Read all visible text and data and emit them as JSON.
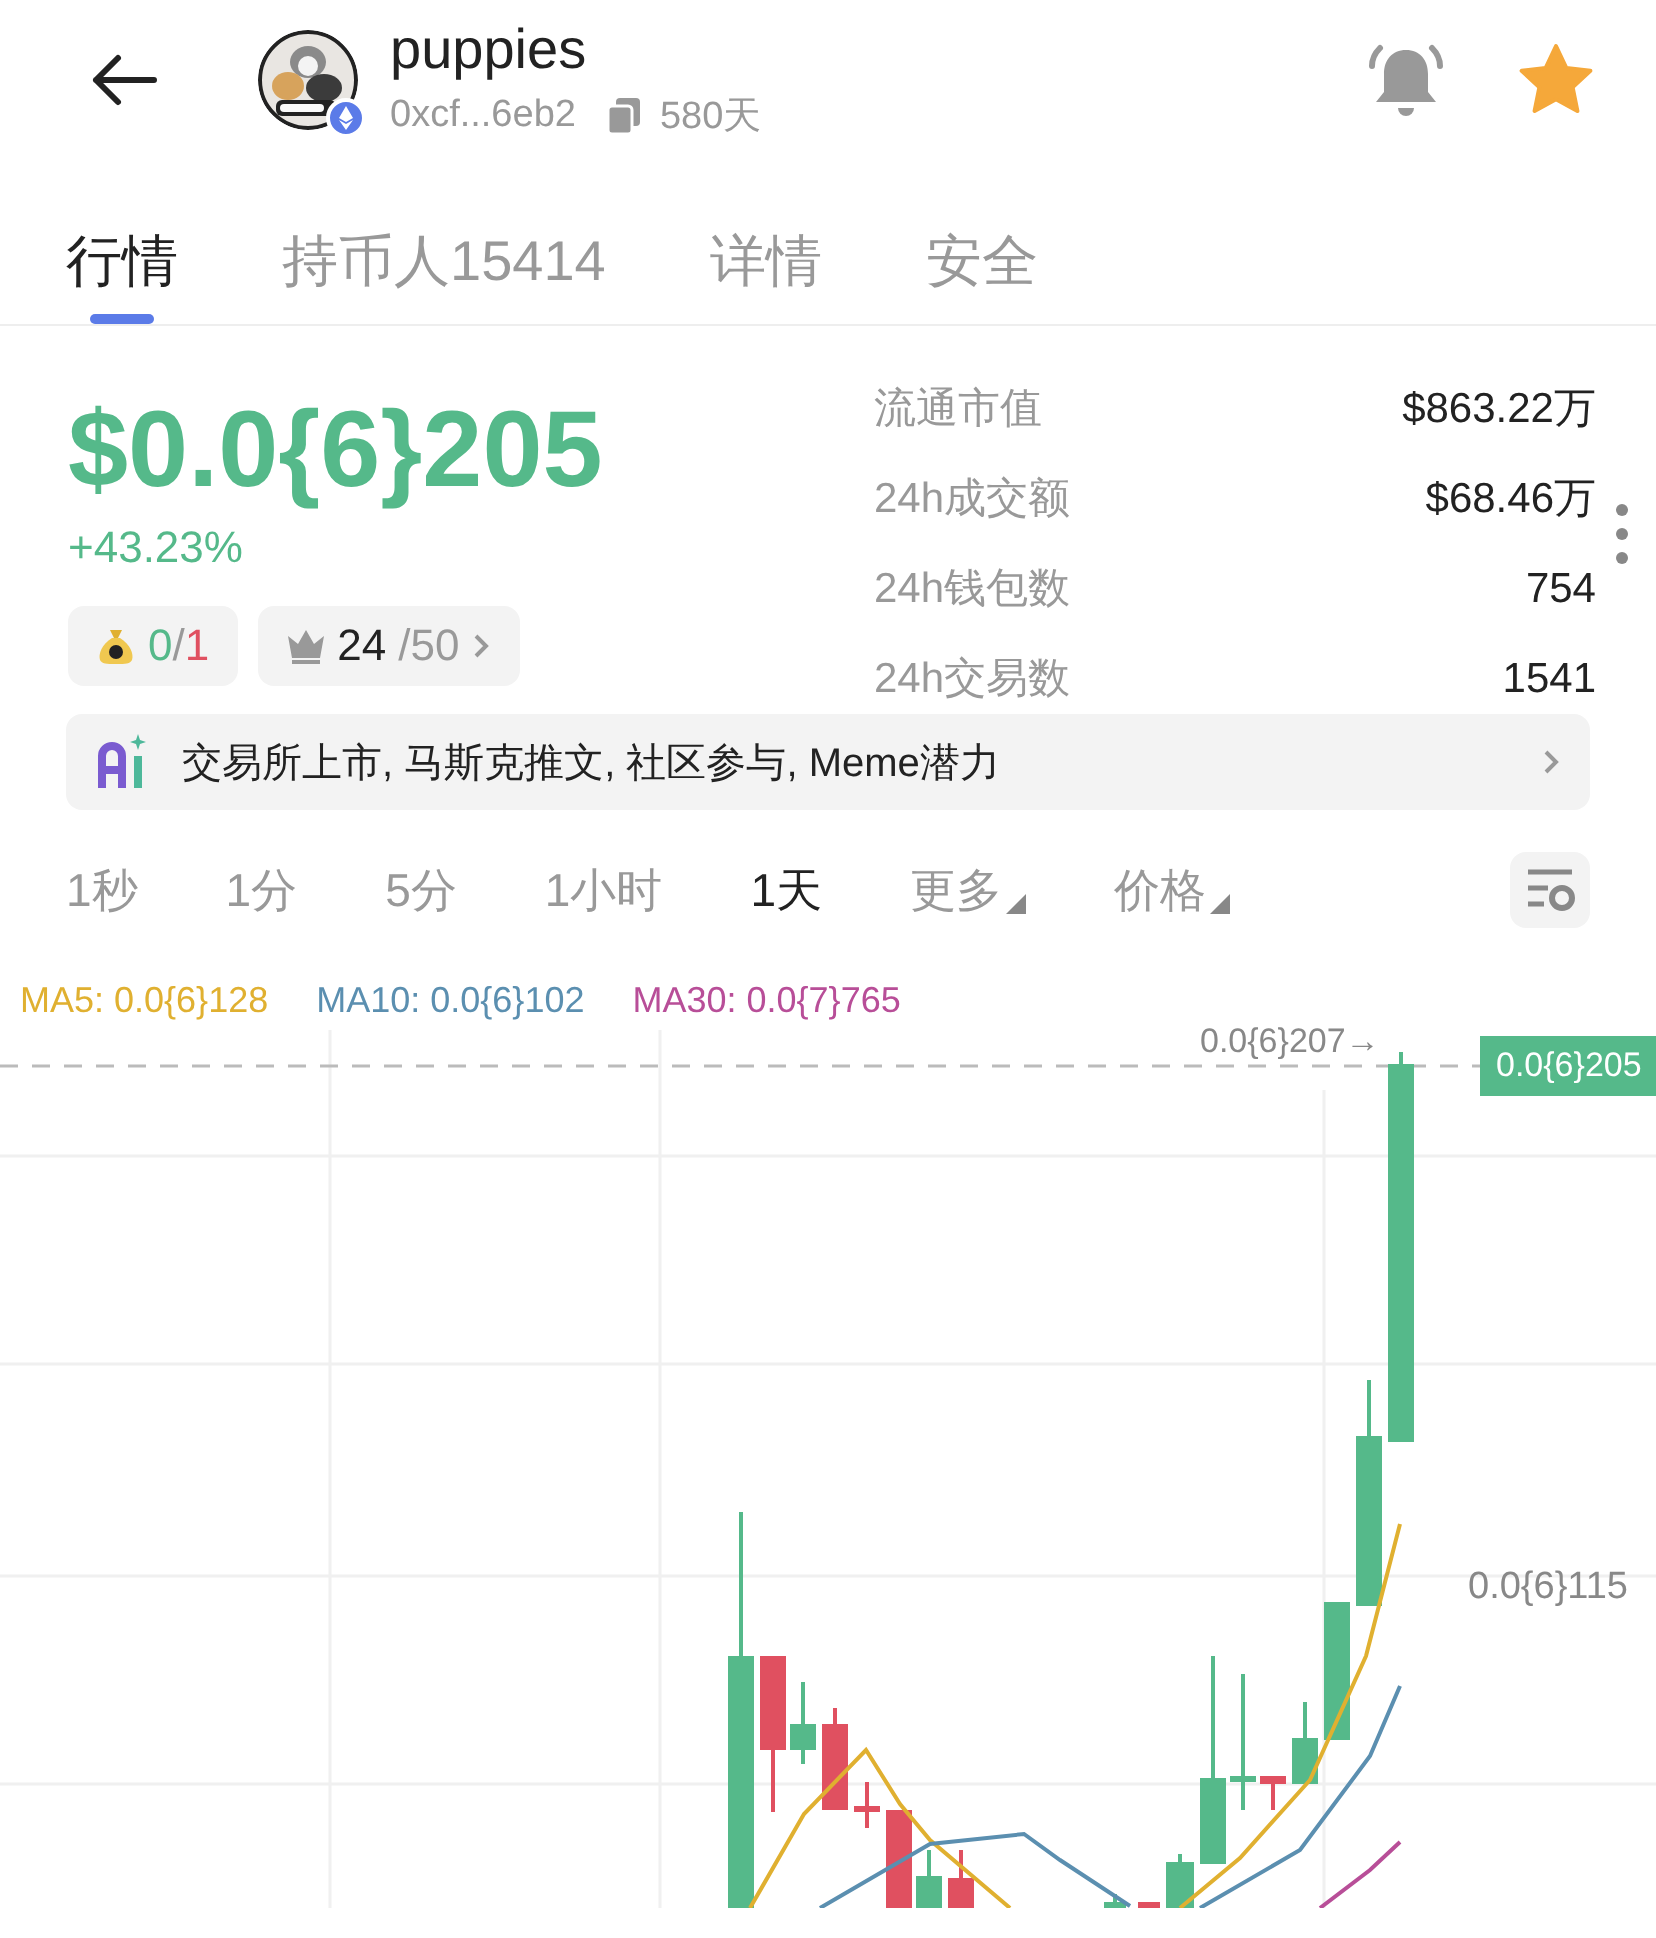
{
  "header": {
    "name": "puppies",
    "address": "0xcf...6eb2",
    "age": "580天",
    "alert_on": false,
    "favorite": true
  },
  "tabs": [
    {
      "label": "行情",
      "selected": true
    },
    {
      "label": "持币人15414",
      "selected": false
    },
    {
      "label": "详情",
      "selected": false
    },
    {
      "label": "安全",
      "selected": false
    }
  ],
  "price": {
    "value": "$0.0{6}205",
    "change": "+43.23%"
  },
  "badges": {
    "ratio": {
      "first": "0",
      "separator": "/",
      "second": "1"
    },
    "rank": {
      "value": "24",
      "total": "/50"
    }
  },
  "stats": [
    {
      "label": "流通市值",
      "value": "$863.22万"
    },
    {
      "label": "24h成交额",
      "value": "$68.46万"
    },
    {
      "label": "24h钱包数",
      "value": "754"
    },
    {
      "label": "24h交易数",
      "value": "1541"
    }
  ],
  "ai_summary": "交易所上市, 马斯克推文, 社区参与, Meme潜力",
  "intervals": [
    {
      "label": "1秒",
      "selected": false,
      "kind": "plain"
    },
    {
      "label": "1分",
      "selected": false,
      "kind": "plain"
    },
    {
      "label": "5分",
      "selected": false,
      "kind": "plain"
    },
    {
      "label": "1小时",
      "selected": false,
      "kind": "plain"
    },
    {
      "label": "1天",
      "selected": true,
      "kind": "plain"
    },
    {
      "label": "更多",
      "selected": false,
      "kind": "dropdown"
    },
    {
      "label": "价格",
      "selected": false,
      "kind": "dropdown"
    }
  ],
  "moving_averages": [
    {
      "label": "MA5: 0.0{6}128",
      "color": "#e0b030"
    },
    {
      "label": "MA10: 0.0{6}102",
      "color": "#5b8fb0"
    },
    {
      "label": "MA30: 0.0{7}765",
      "color": "#b84e98"
    }
  ],
  "chart": {
    "high_marker": "0.0{6}207→",
    "axis_labels": [
      "0.0{6}115"
    ],
    "current_price": "0.0{6}205"
  }
}
